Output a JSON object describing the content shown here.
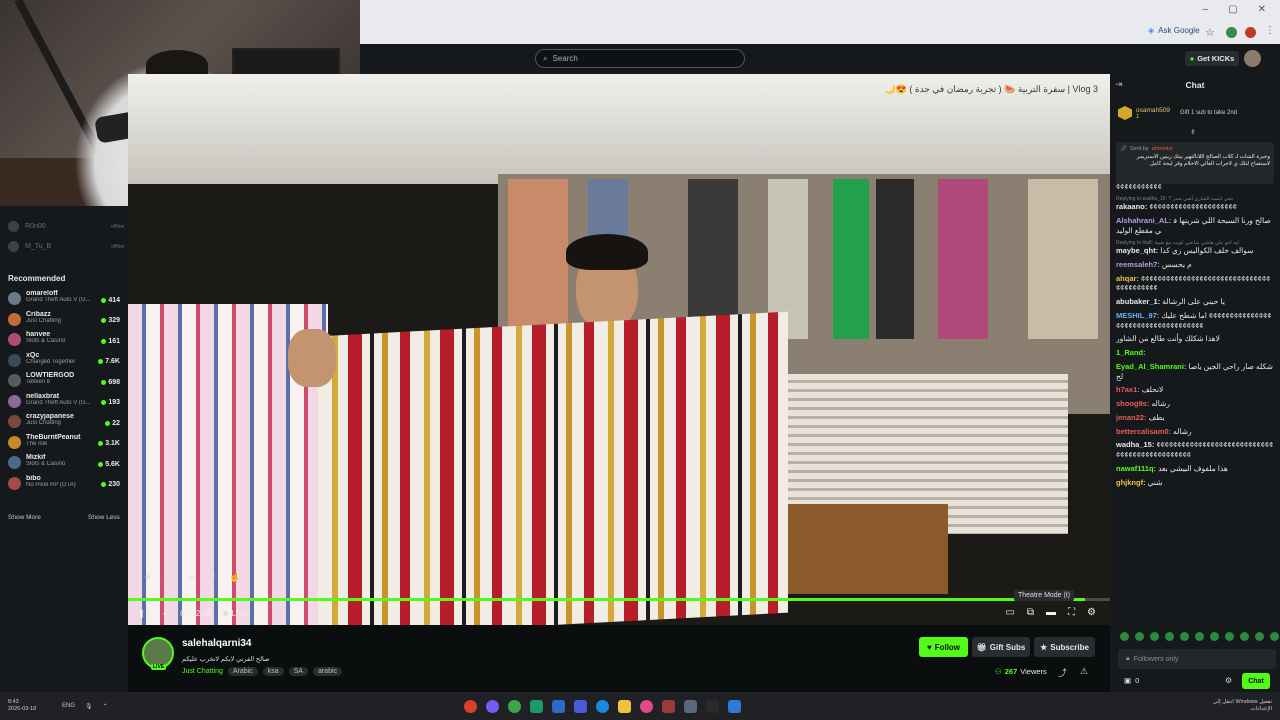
{
  "browser": {
    "ask_google": "Ask Google",
    "buttons": [
      "–",
      "▢",
      "✕"
    ]
  },
  "topbar": {
    "search_placeholder": "Search",
    "get_kicks": "Get KICKs"
  },
  "sidebar": {
    "following": [
      {
        "name": "R0n00",
        "status": "offline"
      },
      {
        "name": "M_Tu_B",
        "status": "offline"
      }
    ],
    "recommended_heading": "Recommended",
    "recommended": [
      {
        "name": "omareloff",
        "category": "Grand Theft Auto V (G...",
        "viewers": "414",
        "color": "#6a7a8a"
      },
      {
        "name": "Cribazz",
        "category": "Just Chatting",
        "viewers": "329",
        "color": "#c46a3a"
      },
      {
        "name": "hanvee",
        "category": "Slots & Casino",
        "viewers": "161",
        "color": "#b04a7a"
      },
      {
        "name": "xQc",
        "category": "Changed Together",
        "viewers": "7.6K",
        "color": "#3a4a5a"
      },
      {
        "name": "LOWTIERGOD",
        "category": "Tekken 8",
        "viewers": "698",
        "color": "#5a5a5a"
      },
      {
        "name": "nellaxbrat",
        "category": "Grand Theft Auto V (G...",
        "viewers": "193",
        "color": "#8a6a9a"
      },
      {
        "name": "crazyjapanese",
        "category": "Just Chatting",
        "viewers": "22",
        "color": "#7a4a3a"
      },
      {
        "name": "TheBurntPeanut",
        "category": "The Isle",
        "viewers": "3.1K",
        "color": "#c48a2a"
      },
      {
        "name": "Mizkif",
        "category": "Slots & Casino",
        "viewers": "5.6K",
        "color": "#4a6a8a"
      },
      {
        "name": "bibo",
        "category": "No Pixel RP (GTA)",
        "viewers": "230",
        "color": "#a44a4a"
      }
    ],
    "show_more": "Show More",
    "show_less": "Show Less"
  },
  "video": {
    "title_overlay": "Vlog 3 | سفرة التربية 🍉 ( تجربة رمضان في جدة ) 😍🌙",
    "time": "00:42:38",
    "live_label": "LIVE",
    "progress": 0.975,
    "tooltip": "Theatre Mode (t)"
  },
  "channel": {
    "name": "salehalqarni34",
    "title": "صالح القرني لايكم لاتخرب عليكم",
    "category": "Just Chatting",
    "tags": [
      "Arabic",
      "ksa",
      "SA",
      "arabic"
    ],
    "follow": "Follow",
    "gift_subs": "Gift Subs",
    "subscribe": "Subscribe",
    "viewers_count": "267",
    "viewers_label": "Viewers",
    "live_badge": "LIVE"
  },
  "chat": {
    "header": "Chat",
    "gifter": {
      "name": "osamah509",
      "count": "1",
      "message": "Gift 1 sub to take 2nd"
    },
    "pinned": {
      "label": "Sent by",
      "by": "ahmedxr",
      "body": "وجبرة الشات لـ كلاب الصالح اللابالتهير بيتك ريبين الاستريمر لاستضاح لتلك ي لاجرات العالي الاخلام وقر ليحة كامل"
    },
    "messages": [
      {
        "user": "",
        "color": "#e8e8e8",
        "text": "¢¢¢¢¢¢¢¢¢¢¢",
        "reply": ""
      },
      {
        "user": "rakaano:",
        "color": "#e8e8e8",
        "text": "¢¢¢¢¢¢¢¢¢¢¢¢¢¢¢¢¢¢¢¢¢",
        "reply": "Replying to wadha_15: ? بتعي ابتسه الشاري أصي صدر"
      },
      {
        "user": "Alshahrani_AL:",
        "color": "#b59ae6",
        "text": "صالح ورنا السبحة اللي شريتها في مقطع الوليد",
        "reply": ""
      },
      {
        "user": "maybe_qht:",
        "color": "#e8e8e8",
        "text": "سوالف خلف الكواليس زي كذا",
        "reply": "Replying to llrafi: ليه انتو علي هاشي ساعتي كويت مع ضيبة"
      },
      {
        "user": "reemsaleh7:",
        "color": "#b59ae6",
        "text": "م يحسس",
        "reply": ""
      },
      {
        "user": "ahqar:",
        "color": "#f0c040",
        "text": "¢¢¢¢¢¢¢¢¢¢¢¢¢¢¢¢¢¢¢¢¢¢¢¢¢¢¢¢¢¢¢¢¢¢¢¢¢¢¢¢¢",
        "reply": ""
      },
      {
        "user": "abubaker_1:",
        "color": "#e8e8e8",
        "text": "يا حبني على الرشالة",
        "reply": ""
      },
      {
        "user": "MESHIL_97:",
        "color": "#6ab0f0",
        "text": "اما شطح عليك ¢¢¢¢¢¢¢¢¢¢¢¢¢¢¢¢¢¢¢¢¢¢¢¢¢¢¢¢¢¢¢¢¢¢¢¢",
        "reply": ""
      },
      {
        "user": "",
        "color": "#e8e8e8",
        "text": "لاهذا شكلك وأنت طالع من الشاور",
        "reply": ""
      },
      {
        "user": "1_Rand:",
        "color": "#53fc18",
        "text": "",
        "reply": ""
      },
      {
        "user": "Eyad_Al_Shamrani:",
        "color": "#53fc18",
        "text": "شكله صار راحي الجين ياصالح",
        "reply": ""
      },
      {
        "user": "h7ax1:",
        "color": "#e85a5a",
        "text": "لانحلف",
        "reply": ""
      },
      {
        "user": "shoog9s:",
        "color": "#e85a5a",
        "text": "رشاله",
        "reply": ""
      },
      {
        "user": "jenan22:",
        "color": "#e85a5a",
        "text": "يطف",
        "reply": ""
      },
      {
        "user": "bettercalisam0:",
        "color": "#e85a5a",
        "text": "رشاله",
        "reply": ""
      },
      {
        "user": "wadha_15:",
        "color": "#e8e8e8",
        "text": "¢¢¢¢¢¢¢¢¢¢¢¢¢¢¢¢¢¢¢¢¢¢¢¢¢¢¢¢¢¢¢¢¢¢¢¢¢¢¢¢¢¢¢¢¢¢",
        "reply": ""
      },
      {
        "user": "nawaf111q:",
        "color": "#53fc18",
        "text": "هذا ملفوف البيشي بعد",
        "reply": ""
      },
      {
        "user": "ghjkngf:",
        "color": "#f0c040",
        "text": "شني",
        "reply": ""
      }
    ],
    "input_placeholder": "Followers only",
    "footer_count": "0",
    "chat_button": "Chat"
  },
  "taskbar": {
    "time": "8:43",
    "date": "2026-03-18",
    "lang": "ENG",
    "right_text": "تفعيل Windows انتقل إلى الإعدادات"
  }
}
